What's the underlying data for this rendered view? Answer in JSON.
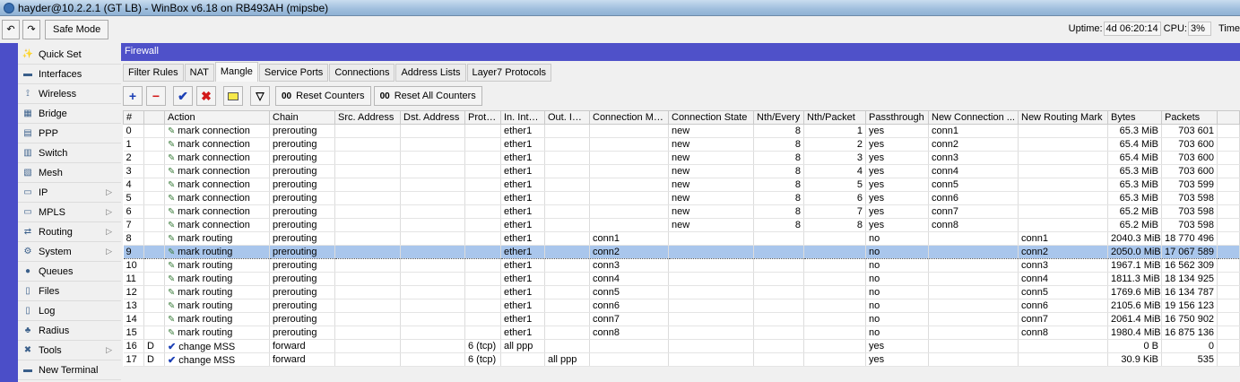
{
  "window": {
    "title": "hayder@10.2.2.1 (GT LB) - WinBox v6.18 on RB493AH (mipsbe)"
  },
  "toolbar": {
    "undo_icon": "undo-icon",
    "redo_icon": "redo-icon",
    "safe_mode": "Safe Mode"
  },
  "status": {
    "uptime_label": "Uptime:",
    "uptime": "4d 06:20:14",
    "cpu_label": "CPU:",
    "cpu": "3%",
    "time_label": "Time"
  },
  "sidebar": {
    "items": [
      {
        "label": "Quick Set",
        "icon": "wand-icon",
        "sub": false
      },
      {
        "label": "Interfaces",
        "icon": "interface-icon",
        "sub": false
      },
      {
        "label": "Wireless",
        "icon": "antenna-icon",
        "sub": false
      },
      {
        "label": "Bridge",
        "icon": "bridge-icon",
        "sub": false
      },
      {
        "label": "PPP",
        "icon": "ppp-icon",
        "sub": false
      },
      {
        "label": "Switch",
        "icon": "switch-icon",
        "sub": false
      },
      {
        "label": "Mesh",
        "icon": "mesh-icon",
        "sub": false
      },
      {
        "label": "IP",
        "icon": "ip-icon",
        "sub": true
      },
      {
        "label": "MPLS",
        "icon": "mpls-icon",
        "sub": true
      },
      {
        "label": "Routing",
        "icon": "routing-icon",
        "sub": true
      },
      {
        "label": "System",
        "icon": "gear-icon",
        "sub": true
      },
      {
        "label": "Queues",
        "icon": "queues-icon",
        "sub": false
      },
      {
        "label": "Files",
        "icon": "files-icon",
        "sub": false
      },
      {
        "label": "Log",
        "icon": "log-icon",
        "sub": false
      },
      {
        "label": "Radius",
        "icon": "radius-icon",
        "sub": false
      },
      {
        "label": "Tools",
        "icon": "tools-icon",
        "sub": true
      },
      {
        "label": "New Terminal",
        "icon": "terminal-icon",
        "sub": false
      }
    ]
  },
  "firewall": {
    "title": "Firewall",
    "tabs": [
      "Filter Rules",
      "NAT",
      "Mangle",
      "Service Ports",
      "Connections",
      "Address Lists",
      "Layer7 Protocols"
    ],
    "active_tab": "Mangle",
    "reset_counters": "Reset Counters",
    "reset_all_counters": "Reset All Counters",
    "counter_glyph": "00",
    "columns": [
      "#",
      "",
      "Action",
      "Chain",
      "Src. Address",
      "Dst. Address",
      "Proto...",
      "In. Inter...",
      "Out. Int...",
      "Connection Mark",
      "Connection State",
      "Nth/Every",
      "Nth/Packet",
      "Passthrough",
      "New Connection ...",
      "New Routing Mark",
      "Bytes",
      "Packets"
    ],
    "rows": [
      [
        "0",
        "",
        "mark connection",
        "prerouting",
        "",
        "",
        "",
        "ether1",
        "",
        "",
        "new",
        "8",
        "1",
        "yes",
        "conn1",
        "",
        "65.3 MiB",
        "703 601"
      ],
      [
        "1",
        "",
        "mark connection",
        "prerouting",
        "",
        "",
        "",
        "ether1",
        "",
        "",
        "new",
        "8",
        "2",
        "yes",
        "conn2",
        "",
        "65.4 MiB",
        "703 600"
      ],
      [
        "2",
        "",
        "mark connection",
        "prerouting",
        "",
        "",
        "",
        "ether1",
        "",
        "",
        "new",
        "8",
        "3",
        "yes",
        "conn3",
        "",
        "65.4 MiB",
        "703 600"
      ],
      [
        "3",
        "",
        "mark connection",
        "prerouting",
        "",
        "",
        "",
        "ether1",
        "",
        "",
        "new",
        "8",
        "4",
        "yes",
        "conn4",
        "",
        "65.3 MiB",
        "703 600"
      ],
      [
        "4",
        "",
        "mark connection",
        "prerouting",
        "",
        "",
        "",
        "ether1",
        "",
        "",
        "new",
        "8",
        "5",
        "yes",
        "conn5",
        "",
        "65.3 MiB",
        "703 599"
      ],
      [
        "5",
        "",
        "mark connection",
        "prerouting",
        "",
        "",
        "",
        "ether1",
        "",
        "",
        "new",
        "8",
        "6",
        "yes",
        "conn6",
        "",
        "65.3 MiB",
        "703 598"
      ],
      [
        "6",
        "",
        "mark connection",
        "prerouting",
        "",
        "",
        "",
        "ether1",
        "",
        "",
        "new",
        "8",
        "7",
        "yes",
        "conn7",
        "",
        "65.2 MiB",
        "703 598"
      ],
      [
        "7",
        "",
        "mark connection",
        "prerouting",
        "",
        "",
        "",
        "ether1",
        "",
        "",
        "new",
        "8",
        "8",
        "yes",
        "conn8",
        "",
        "65.2 MiB",
        "703 598"
      ],
      [
        "8",
        "",
        "mark routing",
        "prerouting",
        "",
        "",
        "",
        "ether1",
        "",
        "conn1",
        "",
        "",
        "",
        "no",
        "",
        "conn1",
        "2040.3 MiB",
        "18 770 496"
      ],
      [
        "9",
        "",
        "mark routing",
        "prerouting",
        "",
        "",
        "",
        "ether1",
        "",
        "conn2",
        "",
        "",
        "",
        "no",
        "",
        "conn2",
        "2050.0 MiB",
        "17 067 589"
      ],
      [
        "10",
        "",
        "mark routing",
        "prerouting",
        "",
        "",
        "",
        "ether1",
        "",
        "conn3",
        "",
        "",
        "",
        "no",
        "",
        "conn3",
        "1967.1 MiB",
        "16 562 309"
      ],
      [
        "11",
        "",
        "mark routing",
        "prerouting",
        "",
        "",
        "",
        "ether1",
        "",
        "conn4",
        "",
        "",
        "",
        "no",
        "",
        "conn4",
        "1811.3 MiB",
        "18 134 925"
      ],
      [
        "12",
        "",
        "mark routing",
        "prerouting",
        "",
        "",
        "",
        "ether1",
        "",
        "conn5",
        "",
        "",
        "",
        "no",
        "",
        "conn5",
        "1769.6 MiB",
        "16 134 787"
      ],
      [
        "13",
        "",
        "mark routing",
        "prerouting",
        "",
        "",
        "",
        "ether1",
        "",
        "conn6",
        "",
        "",
        "",
        "no",
        "",
        "conn6",
        "2105.6 MiB",
        "19 156 123"
      ],
      [
        "14",
        "",
        "mark routing",
        "prerouting",
        "",
        "",
        "",
        "ether1",
        "",
        "conn7",
        "",
        "",
        "",
        "no",
        "",
        "conn7",
        "2061.4 MiB",
        "16 750 902"
      ],
      [
        "15",
        "",
        "mark routing",
        "prerouting",
        "",
        "",
        "",
        "ether1",
        "",
        "conn8",
        "",
        "",
        "",
        "no",
        "",
        "conn8",
        "1980.4 MiB",
        "16 875 136"
      ],
      [
        "16",
        "D",
        "change MSS",
        "forward",
        "",
        "",
        "6 (tcp)",
        "all ppp",
        "",
        "",
        "",
        "",
        "",
        "yes",
        "",
        "",
        "0 B",
        "0"
      ],
      [
        "17",
        "D",
        "change MSS",
        "forward",
        "",
        "",
        "6 (tcp)",
        "",
        "all ppp",
        "",
        "",
        "",
        "",
        "yes",
        "",
        "",
        "30.9 KiB",
        "535"
      ]
    ],
    "selected_row": 9
  }
}
